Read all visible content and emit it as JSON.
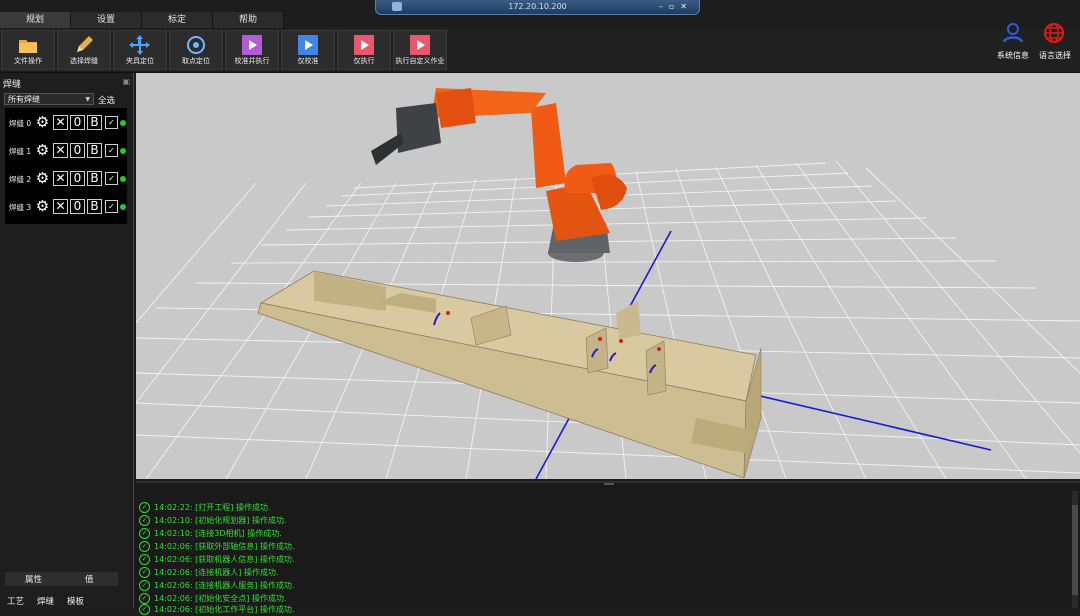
{
  "window": {
    "title": "172.20.10.200"
  },
  "menu": {
    "tabs": [
      "规划",
      "设置",
      "标定",
      "帮助"
    ]
  },
  "toolbar": {
    "buttons": [
      {
        "label": "文件操作",
        "icon": "folder-icon"
      },
      {
        "label": "选择焊缝",
        "icon": "pencil-icon"
      },
      {
        "label": "夹具定位",
        "icon": "move-arrows-icon"
      },
      {
        "label": "取点定位",
        "icon": "target-icon"
      },
      {
        "label": "校准并执行",
        "icon": "play-icon"
      },
      {
        "label": "仅校准",
        "icon": "play-icon"
      },
      {
        "label": "仅执行",
        "icon": "play-icon"
      },
      {
        "label": "执行自定义作业",
        "icon": "play-icon"
      }
    ],
    "right": {
      "system_info": "系统信息",
      "language": "语言选择"
    }
  },
  "left_panel": {
    "title": "焊缝",
    "filter_value": "所有焊缝",
    "select_all": "全选",
    "seams": [
      {
        "name": "焊缝 0",
        "count": "0",
        "mode": "B"
      },
      {
        "name": "焊缝 1",
        "count": "0",
        "mode": "B"
      },
      {
        "name": "焊缝 2",
        "count": "0",
        "mode": "B"
      },
      {
        "name": "焊缝 3",
        "count": "0",
        "mode": "B"
      }
    ],
    "prop_headers": [
      "属性",
      "值"
    ],
    "bottom_tabs": [
      "工艺",
      "焊缝",
      "模板"
    ]
  },
  "log": {
    "lines": [
      "14:02:22: [打开工程] 操作成功.",
      "14:02:10: [初始化规划器] 操作成功.",
      "14:02:10: [连接3D相机] 操作成功.",
      "14:02:06: [获取外部轴信息] 操作成功.",
      "14:02:06: [获取机器人信息] 操作成功.",
      "14:02:06: [连接机器人] 操作成功.",
      "14:02:06: [连接机器人服务] 操作成功.",
      "14:02:06: [初始化安全点] 操作成功.",
      "14:02:06: [初始化工作平台] 操作成功."
    ]
  },
  "colors": {
    "robot": "#f05a14",
    "workpiece": "#d8c9a0",
    "log_text": "#2fe02f",
    "status_dot": "#17d417",
    "axis_blue": "#1a1ad0",
    "accent_blue": "#2a5fd4",
    "accent_red": "#e01818"
  }
}
